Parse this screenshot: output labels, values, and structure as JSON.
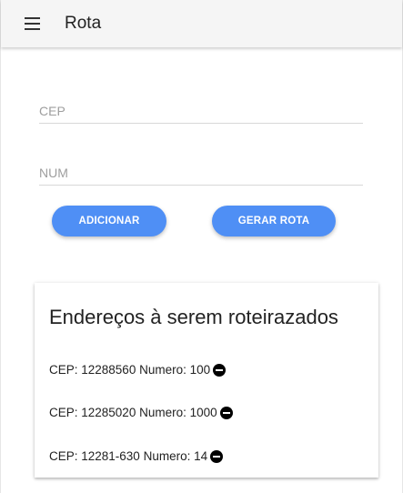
{
  "toolbar": {
    "menu_icon": "menu-icon",
    "title": "Rota"
  },
  "form": {
    "cep_placeholder": "CEP",
    "cep_value": "",
    "num_placeholder": "NUM",
    "num_value": "",
    "add_label": "ADICIONAR",
    "route_label": "GERAR ROTA"
  },
  "colors": {
    "accent": "#4f8ff5",
    "toolbar_bg": "#f5f5f5"
  },
  "card": {
    "title": "Endereços à serem roteirazados",
    "addresses": [
      {
        "text": "CEP: 12288560 Numero: 100",
        "icon": "remove-circle-icon"
      },
      {
        "text": "CEP: 12285020 Numero: 1000",
        "icon": "remove-circle-icon"
      },
      {
        "text": "CEP: 12281-630 Numero: 14",
        "icon": "remove-circle-icon"
      }
    ]
  }
}
